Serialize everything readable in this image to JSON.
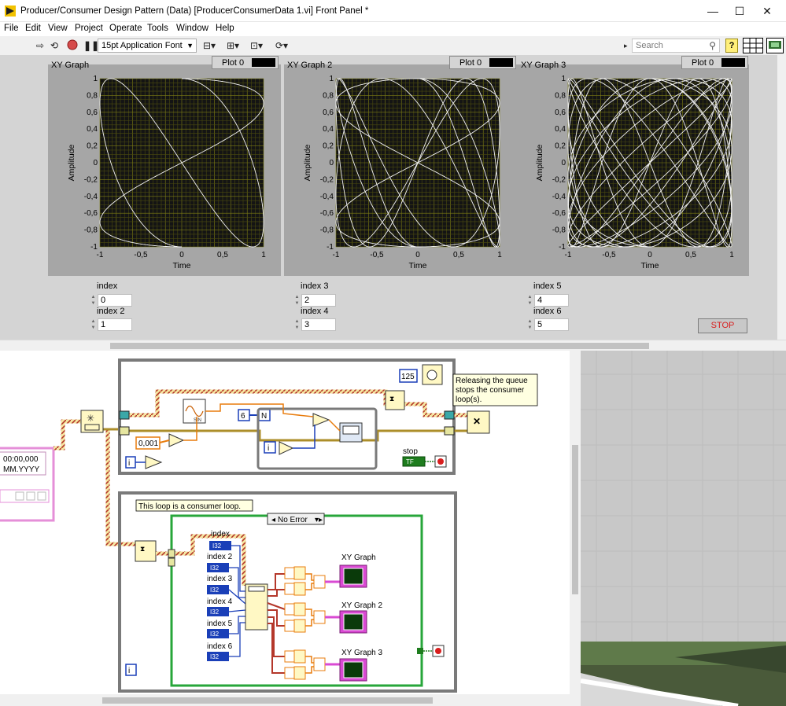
{
  "window": {
    "title": "Producer/Consumer Design Pattern (Data) [ProducerConsumerData 1.vi] Front Panel *",
    "controls": {
      "minimize": "—",
      "maximize": "☐",
      "close": "✕"
    }
  },
  "menu": [
    "File",
    "Edit",
    "View",
    "Project",
    "Operate",
    "Tools",
    "Window",
    "Help"
  ],
  "toolbar": {
    "font_select": "15pt Application Font",
    "search_placeholder": "Search",
    "help_label": "?"
  },
  "graphs": [
    {
      "title": "XY Graph",
      "legend": "Plot 0",
      "xlabel": "Time",
      "ylabel": "Amplitude",
      "x_ticks": [
        "-1",
        "-0,5",
        "0",
        "0,5",
        "1"
      ],
      "y_ticks": [
        "1",
        "0,8",
        "0,6",
        "0,4",
        "0,2",
        "0",
        "-0,2",
        "-0,4",
        "-0,6",
        "-0,8",
        "-1"
      ]
    },
    {
      "title": "XY Graph 2",
      "legend": "Plot 0",
      "xlabel": "Time",
      "ylabel": "Amplitude",
      "x_ticks": [
        "-1",
        "-0,5",
        "0",
        "0,5",
        "1"
      ],
      "y_ticks": [
        "1",
        "0,8",
        "0,6",
        "0,4",
        "0,2",
        "0",
        "-0,2",
        "-0,4",
        "-0,6",
        "-0,8",
        "-1"
      ]
    },
    {
      "title": "XY Graph 3",
      "legend": "Plot 0",
      "xlabel": "Time",
      "ylabel": "Amplitude",
      "x_ticks": [
        "-1",
        "-0,5",
        "0",
        "0,5",
        "1"
      ],
      "y_ticks": [
        "1",
        "0,8",
        "0,6",
        "0,4",
        "0,2",
        "0",
        "-0,2",
        "-0,4",
        "-0,6",
        "-0,8",
        "-1"
      ]
    }
  ],
  "indices": [
    {
      "label": "index",
      "value": "0"
    },
    {
      "label": "index 2",
      "value": "1"
    },
    {
      "label": "index 3",
      "value": "2"
    },
    {
      "label": "index 4",
      "value": "3"
    },
    {
      "label": "index 5",
      "value": "4"
    },
    {
      "label": "index 6",
      "value": "5"
    }
  ],
  "stop_button": "STOP",
  "block_diagram": {
    "timeout": "125",
    "release_note": [
      "Releasing the queue",
      "stops the consumer",
      "loop(s)."
    ],
    "consumer_note": "This loop is a consumer loop.",
    "case_selector": "No Error",
    "stop_label": "stop",
    "stop_bool": "TF",
    "n_label": "N",
    "n_value": "6",
    "dt_value": "0,001",
    "iter_label": "i",
    "timestamp_text": "00:00,000",
    "date_text": "MM.YYYY",
    "index_terms": [
      "index",
      "index 2",
      "index 3",
      "index 4",
      "index 5",
      "index 6"
    ],
    "type_tag": "I32",
    "graph_terms": [
      "XY Graph",
      "XY Graph 2",
      "XY Graph 3"
    ]
  }
}
